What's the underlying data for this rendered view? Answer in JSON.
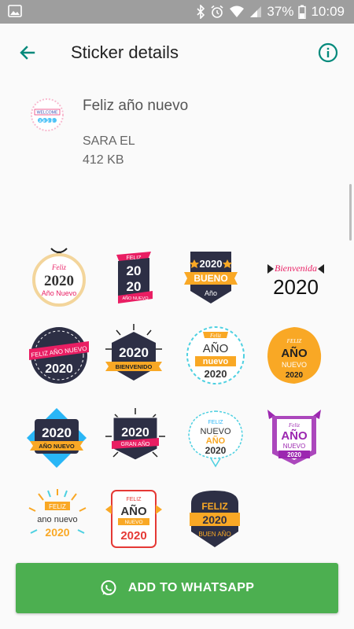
{
  "status_bar": {
    "battery": "37%",
    "time": "10:09"
  },
  "toolbar": {
    "title": "Sticker details"
  },
  "pack": {
    "icon_top": "WELCOME",
    "icon_bottom": "2020",
    "name": "Feliz año nuevo",
    "author": "SARA EL",
    "size": "412 KB"
  },
  "stickers": [
    {
      "lines": [
        "Feliz",
        "2020",
        "Año Nuevo"
      ]
    },
    {
      "lines": [
        "FELIZ",
        "20",
        "20",
        "AÑO NUEVO"
      ]
    },
    {
      "lines": [
        "2020",
        "BUENO",
        "Año"
      ]
    },
    {
      "lines": [
        "Bienvenida",
        "2020"
      ]
    },
    {
      "lines": [
        "FELIZ AÑO NUEVO",
        "2020"
      ]
    },
    {
      "lines": [
        "2020",
        "BIENVENIDO"
      ]
    },
    {
      "lines": [
        "Feliz",
        "AÑO",
        "nuevo",
        "2020"
      ]
    },
    {
      "lines": [
        "FELIZ",
        "AÑO",
        "NUEVO",
        "2020"
      ]
    },
    {
      "lines": [
        "2020",
        "AÑO NUEVO"
      ]
    },
    {
      "lines": [
        "2020",
        "GRAN AÑO"
      ]
    },
    {
      "lines": [
        "FELIZ",
        "NUEVO",
        "AÑO",
        "2020"
      ]
    },
    {
      "lines": [
        "Feliz",
        "AÑO",
        "NUEVO",
        "2020"
      ]
    },
    {
      "lines": [
        "FELIZ",
        "ano nuevo",
        "2020"
      ]
    },
    {
      "lines": [
        "FELIZ",
        "AÑO",
        "NUEVO",
        "2020"
      ]
    },
    {
      "lines": [
        "FELIZ",
        "2020",
        "BUEN AÑO"
      ]
    }
  ],
  "add_button": {
    "label": "ADD TO WHATSAPP"
  },
  "colors": {
    "accent": "#00897b",
    "button": "#4caf50",
    "status_bar": "#9e9e9e"
  }
}
